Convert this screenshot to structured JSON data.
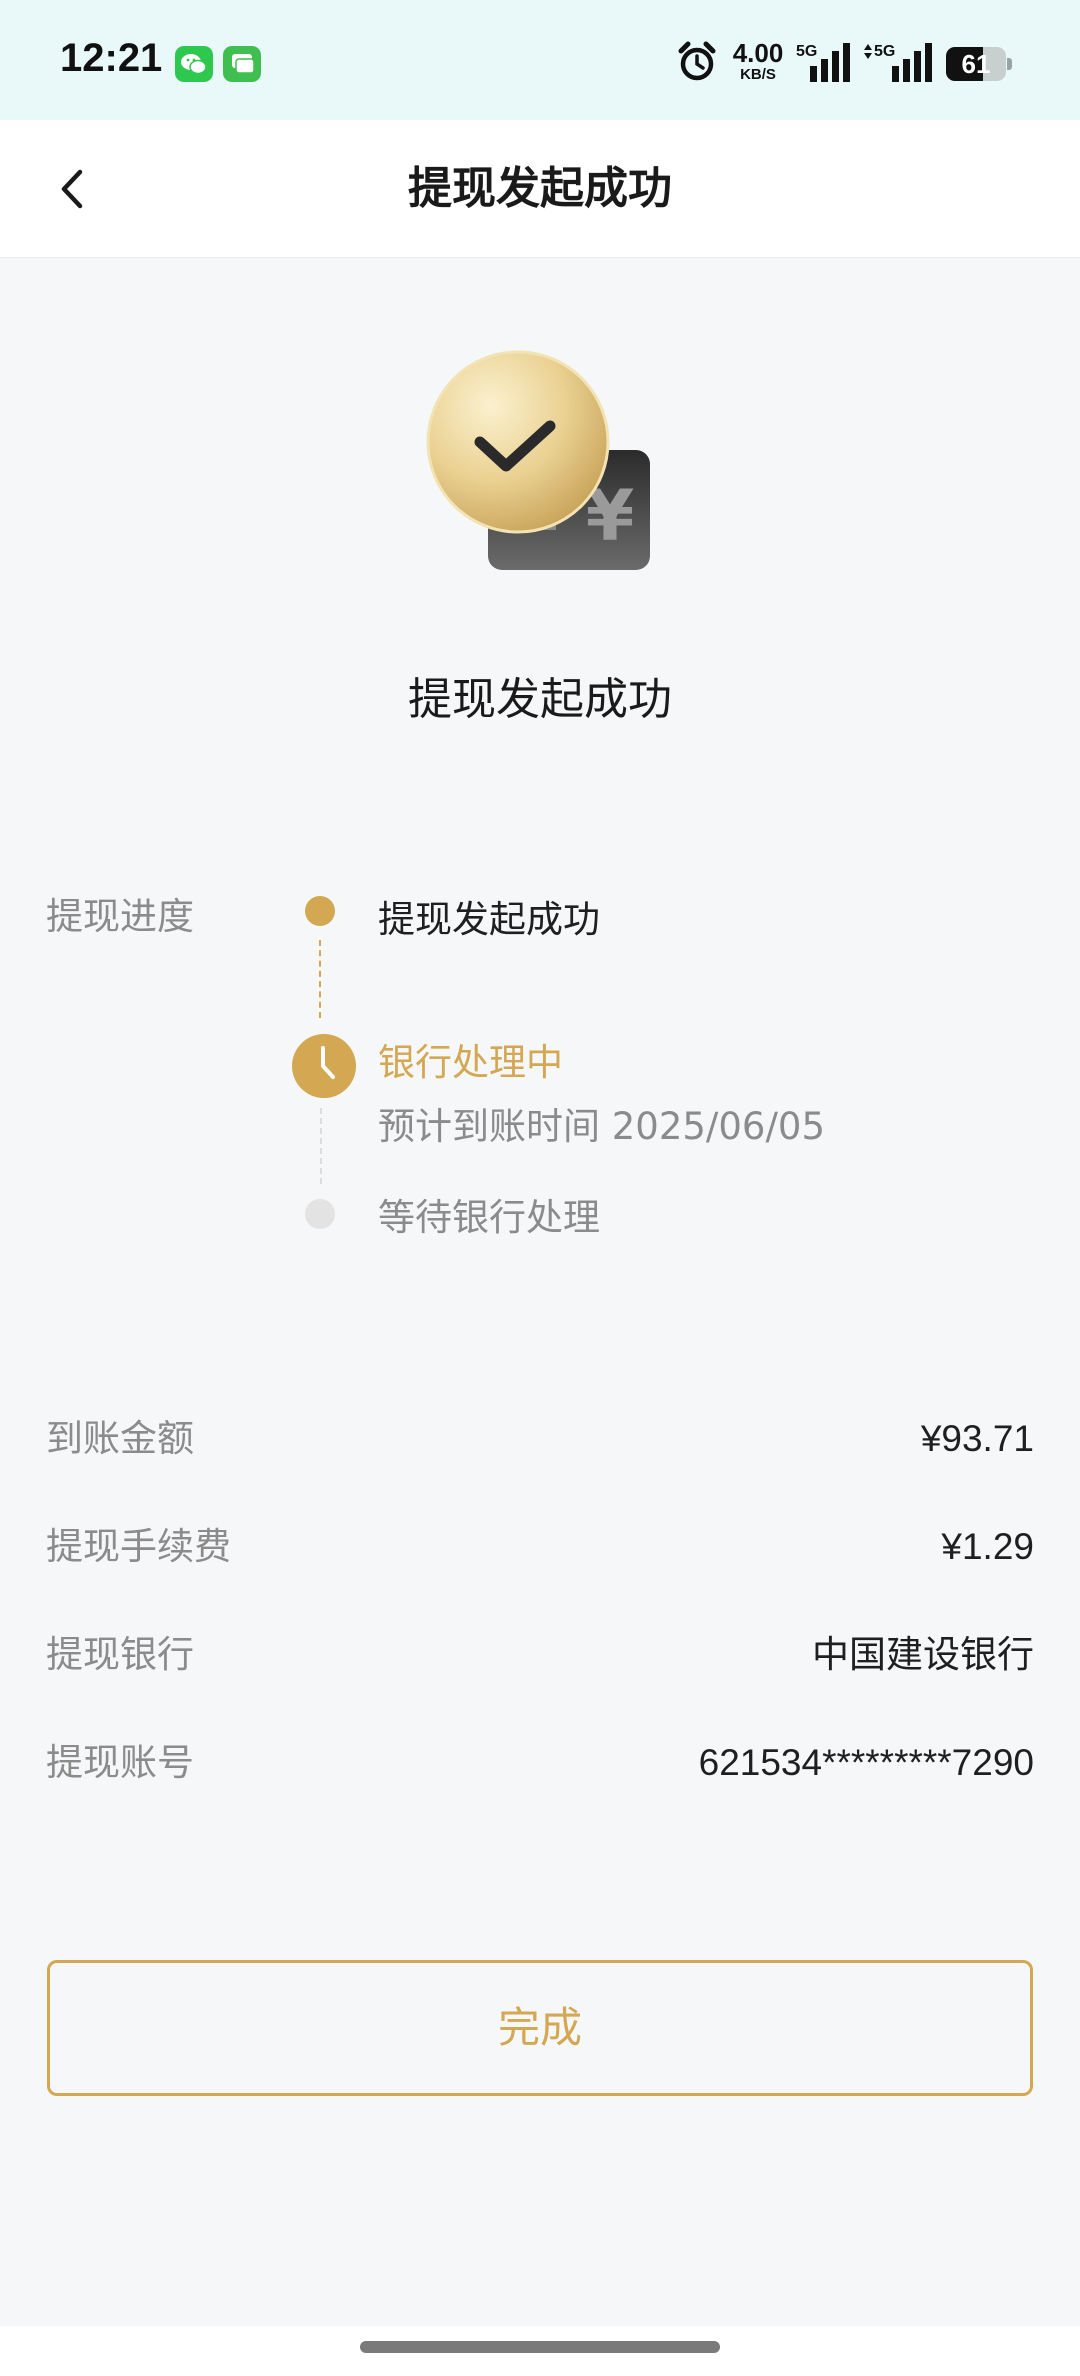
{
  "status_bar": {
    "time": "12:21",
    "net_speed_value": "4.00",
    "net_speed_unit": "KB/S",
    "signal_label": "5G",
    "battery_level": "61",
    "battery_fraction": 0.61
  },
  "nav": {
    "title": "提现发起成功"
  },
  "hero": {
    "title": "提现发起成功"
  },
  "progress": {
    "label": "提现进度",
    "steps": [
      {
        "label": "提现发起成功",
        "state": "done"
      },
      {
        "label": "银行处理中",
        "sub": "预计到账时间 2025/06/05",
        "state": "active"
      },
      {
        "label": "等待银行处理",
        "state": "pending"
      }
    ]
  },
  "details": [
    {
      "label": "到账金额",
      "value": "¥93.71"
    },
    {
      "label": "提现手续费",
      "value": "¥1.29"
    },
    {
      "label": "提现银行",
      "value": "中国建设银行"
    },
    {
      "label": "提现账号",
      "value": "621534*********7290"
    }
  ],
  "done_button": {
    "label": "完成"
  },
  "colors": {
    "accent": "#d4a752",
    "muted_text": "#8b8b8b",
    "background": "#f6f7f9",
    "status_bar_bg": "#e9f8f8"
  }
}
